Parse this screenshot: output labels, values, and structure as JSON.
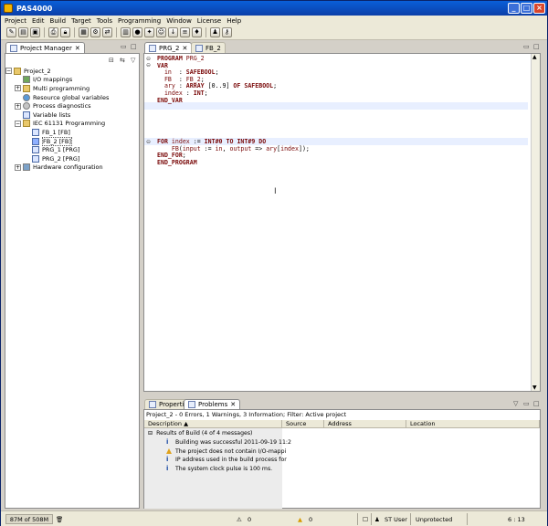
{
  "window": {
    "title": "PAS4000"
  },
  "menu": [
    "Project",
    "Edit",
    "Build",
    "Target",
    "Tools",
    "Programming",
    "Window",
    "License",
    "Help"
  ],
  "project_manager": {
    "tab_label": "Project Manager",
    "tree": [
      {
        "label": "Project_2",
        "indent": 0,
        "toggle": "⊟",
        "icon": "folder"
      },
      {
        "label": "I/O mappings",
        "indent": 1,
        "toggle": "",
        "icon": "net"
      },
      {
        "label": "Multi programming",
        "indent": 1,
        "toggle": "⊞",
        "icon": "folder"
      },
      {
        "label": "Resource global variables",
        "indent": 1,
        "toggle": "",
        "icon": "world"
      },
      {
        "label": "Process diagnostics",
        "indent": 1,
        "toggle": "⊞",
        "icon": "gear"
      },
      {
        "label": "Variable lists",
        "indent": 1,
        "toggle": "",
        "icon": "pou"
      },
      {
        "label": "IEC 61131 Programming",
        "indent": 1,
        "toggle": "⊟",
        "icon": "folder"
      },
      {
        "label": "FB_1 [FB]",
        "indent": 2,
        "toggle": "",
        "icon": "pou"
      },
      {
        "label": "FB_2 [FB]",
        "indent": 2,
        "toggle": "",
        "icon": "pou",
        "selected": true
      },
      {
        "label": "PRG_1 [PRG]",
        "indent": 2,
        "toggle": "",
        "icon": "pou"
      },
      {
        "label": "PRG_2 [PRG]",
        "indent": 2,
        "toggle": "",
        "icon": "pou"
      },
      {
        "label": "Hardware configuration",
        "indent": 1,
        "toggle": "⊞",
        "icon": "hw"
      }
    ]
  },
  "editor": {
    "tabs": [
      {
        "label": "PRG_2",
        "active": true
      },
      {
        "label": "FB_2",
        "active": false
      }
    ],
    "decl_lines": [
      "PROGRAM PRG_2",
      "VAR",
      "  in  : SAFEBOOL;",
      "  FB  : FB_2;",
      "  ary : ARRAY [0..9] OF SAFEBOOL;",
      "  index : INT;",
      "END_VAR"
    ],
    "code_lines": [
      "FOR index := INT#0 TO INT#9 DO",
      "    FB(input := in, output => ary[index]);",
      "END_FOR;",
      "END_PROGRAM"
    ]
  },
  "problems": {
    "tabs": [
      "Properties",
      "Problems"
    ],
    "summary": "Project_2 - 0 Errors, 1 Warnings, 3 Information; Filter: Active project",
    "columns": [
      "Description",
      "Source",
      "Address",
      "Location"
    ],
    "group": "Results of Build (4 of 4 messages)",
    "rows": [
      {
        "kind": "info",
        "text": "Building was successful 2011-09-19 11:2"
      },
      {
        "kind": "warn",
        "text": "The project does not contain I/O-mappi"
      },
      {
        "kind": "info",
        "text": "IP address used in the build process for"
      },
      {
        "kind": "info",
        "text": "The system clock pulse is 100 ms."
      }
    ]
  },
  "status": {
    "memory": "87M of 508M",
    "errors": "0",
    "warnings": "0",
    "user": "ST User",
    "protection": "Unprotected",
    "cursor": "6 : 13"
  }
}
